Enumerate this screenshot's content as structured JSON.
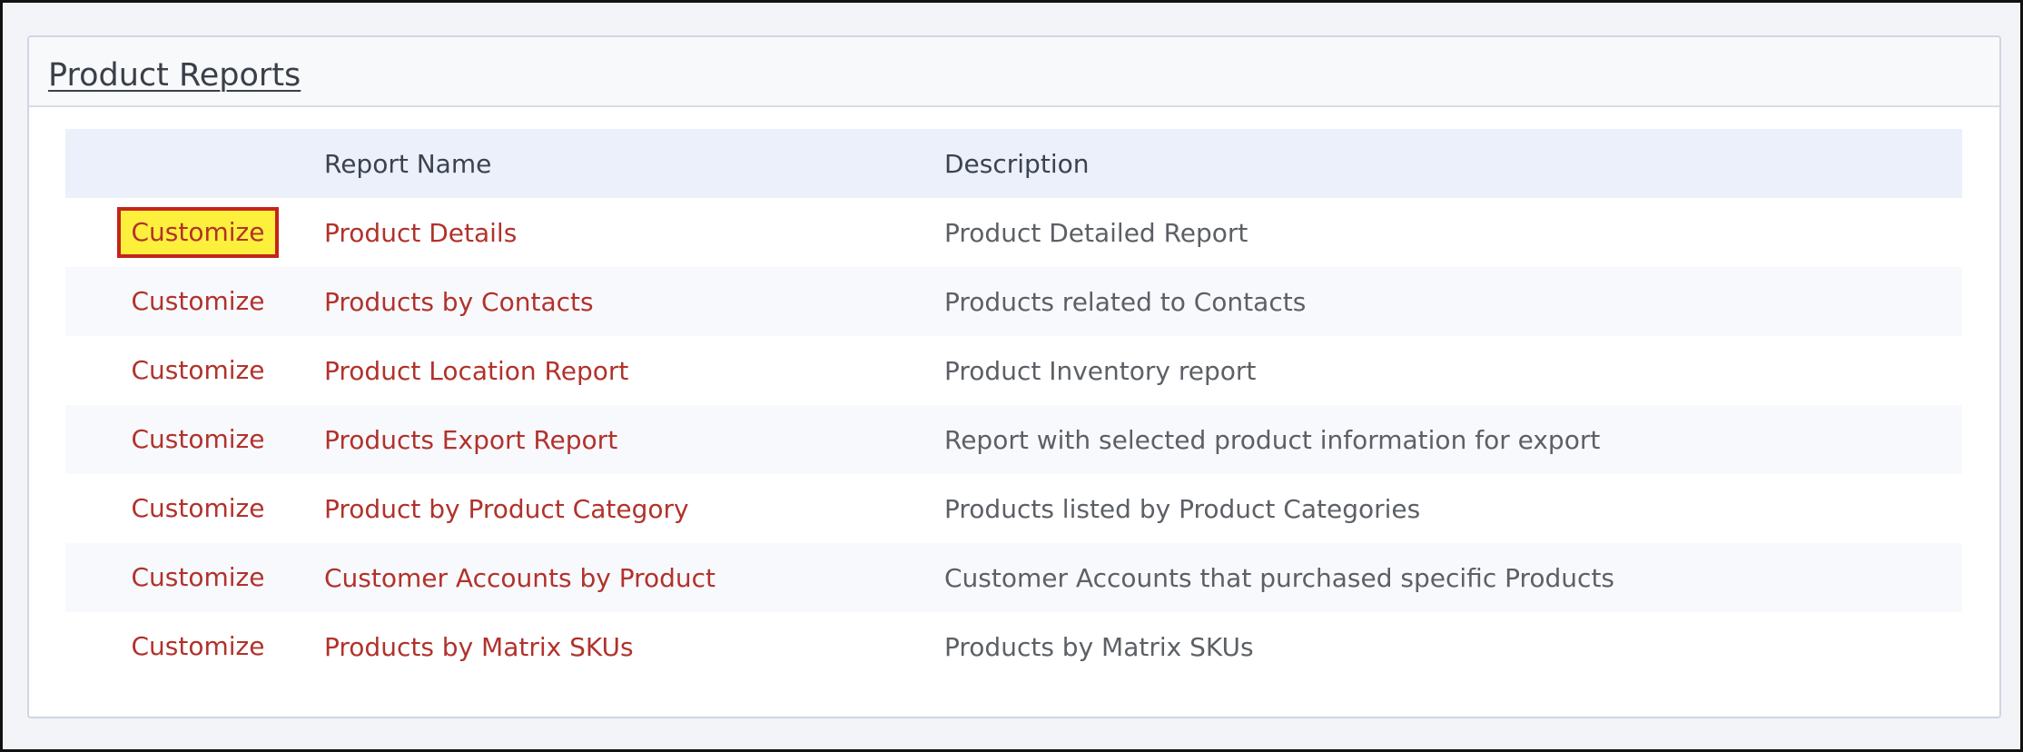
{
  "panel": {
    "title": "Product Reports"
  },
  "table": {
    "headers": {
      "action": "",
      "name": "Report Name",
      "description": "Description"
    },
    "rows": [
      {
        "action": "Customize",
        "name": "Product Details",
        "description": "Product Detailed Report",
        "highlighted": true
      },
      {
        "action": "Customize",
        "name": "Products by Contacts",
        "description": "Products related to Contacts",
        "highlighted": false
      },
      {
        "action": "Customize",
        "name": "Product Location Report",
        "description": "Product Inventory report",
        "highlighted": false
      },
      {
        "action": "Customize",
        "name": "Products Export Report",
        "description": "Report with selected product information for export",
        "highlighted": false
      },
      {
        "action": "Customize",
        "name": "Product by Product Category",
        "description": "Products listed by Product Categories",
        "highlighted": false
      },
      {
        "action": "Customize",
        "name": "Customer Accounts by Product",
        "description": "Customer Accounts that purchased specific Products",
        "highlighted": false
      },
      {
        "action": "Customize",
        "name": "Products by Matrix SKUs",
        "description": "Products by Matrix SKUs",
        "highlighted": false
      }
    ]
  },
  "colors": {
    "link": "#b1322b",
    "highlight_fill": "#fcf03c",
    "highlight_border": "#c4241c",
    "header_bg": "#ecf0fa"
  }
}
